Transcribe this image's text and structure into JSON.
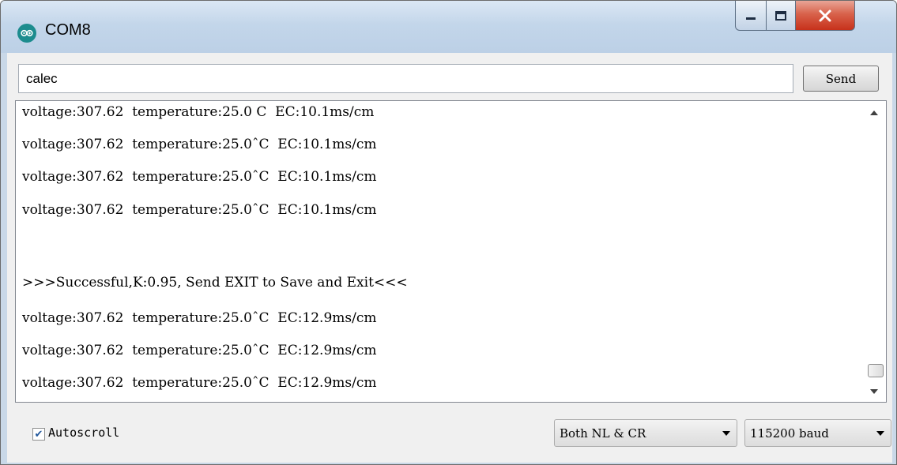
{
  "window": {
    "title": "COM8"
  },
  "command": {
    "value": "calec",
    "send_label": "Send"
  },
  "output_lines": [
    "voltage:307.62  temperature:25.0 C  EC:10.1ms/cm",
    "voltage:307.62  temperature:25.0ˆC  EC:10.1ms/cm",
    "voltage:307.62  temperature:25.0ˆC  EC:10.1ms/cm",
    "voltage:307.62  temperature:25.0ˆC  EC:10.1ms/cm",
    "",
    ">>>Successful,K:0.95, Send EXIT to Save and Exit<<<",
    "voltage:307.62  temperature:25.0ˆC  EC:12.9ms/cm",
    "voltage:307.62  temperature:25.0ˆC  EC:12.9ms/cm",
    "voltage:307.62  temperature:25.0ˆC  EC:12.9ms/cm"
  ],
  "statusbar": {
    "autoscroll_label": "Autoscroll",
    "autoscroll_checked": true,
    "line_ending": "Both NL & CR",
    "baud_rate": "115200 baud"
  },
  "icons": {
    "app": "arduino-icon",
    "minimize": "minimize-icon",
    "maximize": "maximize-icon",
    "close": "close-icon",
    "scroll_up": "chevron-up-icon",
    "scroll_down": "chevron-down-icon",
    "dropdown": "chevron-down-icon"
  },
  "colors": {
    "close_button": "#c7311b",
    "title_bar": "#c3d6ea",
    "app_icon": "#1c8c8e"
  }
}
